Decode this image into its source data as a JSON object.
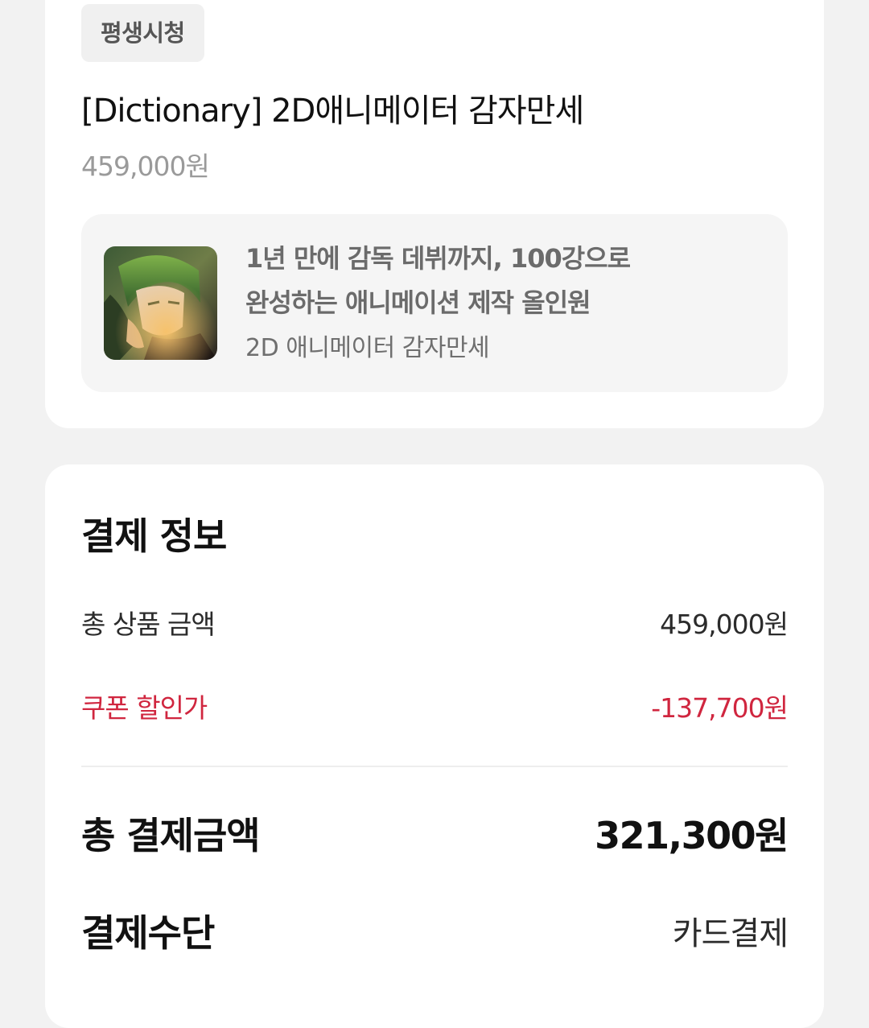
{
  "product": {
    "badge": "평생시청",
    "title": "[Dictionary] 2D애니메이터 감자만세",
    "price": "459,000원",
    "course": {
      "headline_line1": "1년 만에 감독 데뷔까지, 100강으로",
      "headline_line2": "완성하는 애니메이션 제작 올인원",
      "subtitle": "2D 애니메이터 감자만세",
      "thumbnail_icon": "anime-character-thumbnail"
    }
  },
  "payment": {
    "section_title": "결제 정보",
    "subtotal_label": "총 상품 금액",
    "subtotal_value": "459,000원",
    "discount_label": "쿠폰 할인가",
    "discount_value": "-137,700원",
    "total_label": "총 결제금액",
    "total_value": "321,300원",
    "method_label": "결제수단",
    "method_value": "카드결제"
  },
  "colors": {
    "background": "#f2f2f2",
    "card": "#ffffff",
    "discount": "#d0263f",
    "muted_text": "#9a9a9a"
  }
}
